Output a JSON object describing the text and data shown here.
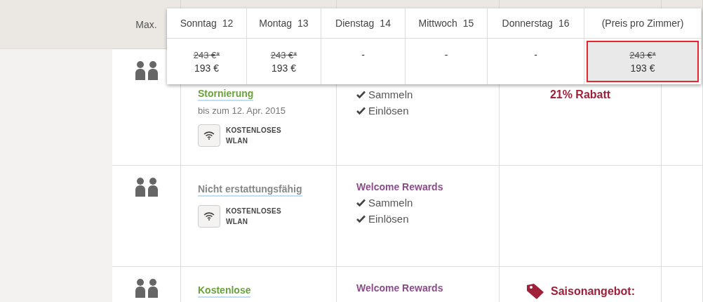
{
  "table": {
    "header": {
      "max_label": "Max."
    },
    "rows": [
      {
        "rate_title": "Stornierung",
        "color": "#6aa23a",
        "rate_note": "bis zum 12. Apr. 2015",
        "amenity": [
          "KOSTENLOSES",
          "WLAN"
        ],
        "rewards": [
          "Sammeln",
          "Einlösen"
        ],
        "offer": "21% Rabatt",
        "offer_icon": false
      },
      {
        "rate_title": "Nicht erstattungsfähig",
        "color": "#888888",
        "amenity": [
          "KOSTENLOSES",
          "WLAN"
        ],
        "rewards_title": "Welcome Rewards",
        "rewards": [
          "Sammeln",
          "Einlösen"
        ]
      },
      {
        "rate_title": "Kostenlose",
        "color": "#6aa23a",
        "rewards_title": "Welcome Rewards",
        "rewards": [],
        "offer": "Saisonangebot:",
        "offer_icon": true
      }
    ]
  },
  "price_popup": {
    "columns": [
      {
        "label": "Sonntag",
        "day": "12",
        "old_price": "243 €*",
        "price": "193 €",
        "selected": false
      },
      {
        "label": "Montag",
        "day": "13",
        "old_price": "243 €*",
        "price": "193 €",
        "selected": false
      },
      {
        "label": "Dienstag",
        "day": "14",
        "price": "-",
        "selected": false
      },
      {
        "label": "Mittwoch",
        "day": "15",
        "price": "-",
        "selected": false
      },
      {
        "label": "Donnerstag",
        "day": "16",
        "price": "-",
        "selected": false
      },
      {
        "label": "(Preis pro Zimmer)",
        "old_price": "243 €*",
        "price": "193 €",
        "selected": true
      }
    ]
  }
}
